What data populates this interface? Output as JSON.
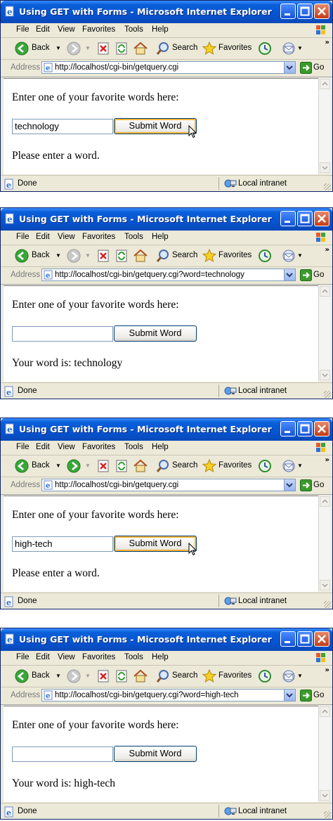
{
  "windows": [
    {
      "title": "Using GET with Forms - Microsoft Internet Explorer",
      "menu": [
        "File",
        "Edit",
        "View",
        "Favorites",
        "Tools",
        "Help"
      ],
      "toolbar": {
        "back": "Back",
        "search": "Search",
        "favorites": "Favorites"
      },
      "address": {
        "label": "Address",
        "url": "http://localhost/cgi-bin/getquery.cgi",
        "go": "Go"
      },
      "page": {
        "prompt": "Enter one of your favorite words here:",
        "input_value": "technology",
        "button": "Submit Word",
        "message": "Please enter a word."
      },
      "status": {
        "text": "Done",
        "zone": "Local intranet"
      }
    },
    {
      "title": "Using GET with Forms - Microsoft Internet Explorer",
      "menu": [
        "File",
        "Edit",
        "View",
        "Favorites",
        "Tools",
        "Help"
      ],
      "toolbar": {
        "back": "Back",
        "search": "Search",
        "favorites": "Favorites"
      },
      "address": {
        "label": "Address",
        "url": "http://localhost/cgi-bin/getquery.cgi?word=technology",
        "go": "Go"
      },
      "page": {
        "prompt": "Enter one of your favorite words here:",
        "input_value": "",
        "button": "Submit Word",
        "message": "Your word is: technology"
      },
      "status": {
        "text": "Done",
        "zone": "Local intranet"
      }
    },
    {
      "title": "Using GET with Forms - Microsoft Internet Explorer",
      "menu": [
        "File",
        "Edit",
        "View",
        "Favorites",
        "Tools",
        "Help"
      ],
      "toolbar": {
        "back": "Back",
        "search": "Search",
        "favorites": "Favorites"
      },
      "address": {
        "label": "Address",
        "url": "http://localhost/cgi-bin/getquery.cgi",
        "go": "Go"
      },
      "page": {
        "prompt": "Enter one of your favorite words here:",
        "input_value": "high-tech",
        "button": "Submit Word",
        "message": "Please enter a word."
      },
      "status": {
        "text": "Done",
        "zone": "Local intranet"
      }
    },
    {
      "title": "Using GET with Forms - Microsoft Internet Explorer",
      "menu": [
        "File",
        "Edit",
        "View",
        "Favorites",
        "Tools",
        "Help"
      ],
      "toolbar": {
        "back": "Back",
        "search": "Search",
        "favorites": "Favorites"
      },
      "address": {
        "label": "Address",
        "url": "http://localhost/cgi-bin/getquery.cgi?word=high-tech",
        "go": "Go"
      },
      "page": {
        "prompt": "Enter one of your favorite words here:",
        "input_value": "",
        "button": "Submit Word",
        "message": "Your word is: high-tech"
      },
      "status": {
        "text": "Done",
        "zone": "Local intranet"
      }
    }
  ],
  "colors": {
    "titlebar": "#0654d2",
    "chrome": "#ece9d8",
    "close": "#c43c16"
  }
}
